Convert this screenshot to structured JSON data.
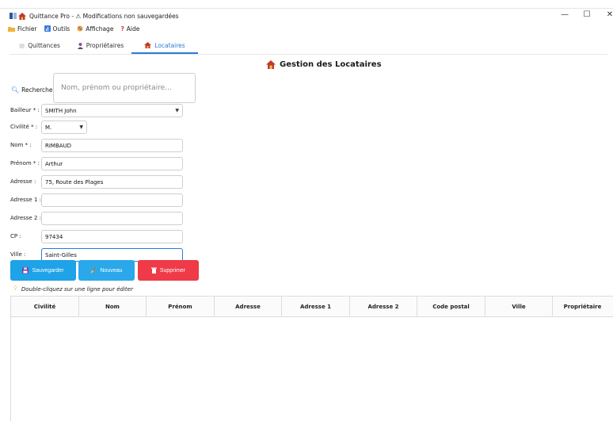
{
  "window": {
    "title": "Quittance Pro - ",
    "unsaved_label": "Modifications non sauvegardées",
    "minimize": "—",
    "maximize": "☐",
    "close": "✕"
  },
  "menu": {
    "items": [
      {
        "label": "Fichier",
        "icon": "folder-icon"
      },
      {
        "label": "Outils",
        "icon": "tools-icon"
      },
      {
        "label": "Affichage",
        "icon": "display-icon"
      },
      {
        "label": "Aide",
        "icon": "question-icon"
      }
    ]
  },
  "tabs": [
    {
      "label": "Quittances",
      "icon": "receipt-icon",
      "active": false
    },
    {
      "label": "Propriétaires",
      "icon": "person-icon",
      "active": false
    },
    {
      "label": "Locataires",
      "icon": "house-icon",
      "active": true
    }
  ],
  "page": {
    "title": "Gestion des Locataires"
  },
  "search": {
    "label": "Rechercher :",
    "placeholder": "Nom, prénom ou propriétaire...",
    "value": ""
  },
  "form": {
    "bailleur": {
      "label": "Bailleur * :",
      "value": "SMITH John"
    },
    "civilite": {
      "label": "Civilité * :",
      "value": "M."
    },
    "nom": {
      "label": "Nom * :",
      "value": "RIMBAUD"
    },
    "prenom": {
      "label": "Prénom * :",
      "value": "Arthur"
    },
    "adresse": {
      "label": "Adresse :",
      "value": "75, Route des Plages"
    },
    "adresse1": {
      "label": "Adresse 1 :",
      "value": ""
    },
    "adresse2": {
      "label": "Adresse 2 :",
      "value": ""
    },
    "cp": {
      "label": "CP :",
      "value": "97434"
    },
    "ville": {
      "label": "Ville :",
      "value": "Saint-Gilles"
    }
  },
  "buttons": {
    "save": "Sauvegarder",
    "new": "Nouveau",
    "delete": "Supprimer"
  },
  "hint": "Double-cliquez sur une ligne pour éditer",
  "table": {
    "columns": [
      "Civilité",
      "Nom",
      "Prénom",
      "Adresse",
      "Adresse 1",
      "Adresse 2",
      "Code postal",
      "Ville",
      "Propriétaire"
    ],
    "rows": []
  },
  "colors": {
    "accent": "#2b7bd6",
    "save": "#1ea2e8",
    "new": "#2aa8ea",
    "delete": "#ef3a47"
  }
}
